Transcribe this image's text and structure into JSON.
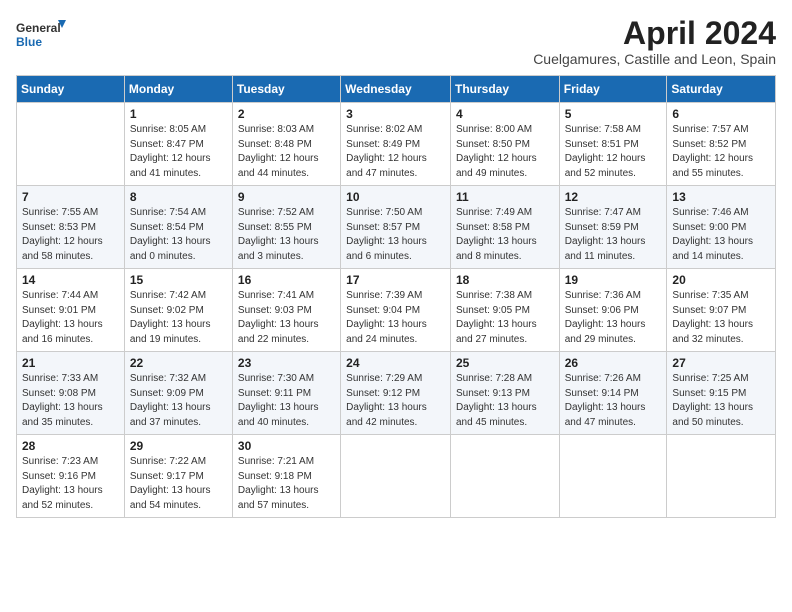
{
  "logo": {
    "text_general": "General",
    "text_blue": "Blue"
  },
  "title": "April 2024",
  "subtitle": "Cuelgamures, Castille and Leon, Spain",
  "calendar": {
    "headers": [
      "Sunday",
      "Monday",
      "Tuesday",
      "Wednesday",
      "Thursday",
      "Friday",
      "Saturday"
    ],
    "weeks": [
      [
        {
          "day": "",
          "info": ""
        },
        {
          "day": "1",
          "info": "Sunrise: 8:05 AM\nSunset: 8:47 PM\nDaylight: 12 hours\nand 41 minutes."
        },
        {
          "day": "2",
          "info": "Sunrise: 8:03 AM\nSunset: 8:48 PM\nDaylight: 12 hours\nand 44 minutes."
        },
        {
          "day": "3",
          "info": "Sunrise: 8:02 AM\nSunset: 8:49 PM\nDaylight: 12 hours\nand 47 minutes."
        },
        {
          "day": "4",
          "info": "Sunrise: 8:00 AM\nSunset: 8:50 PM\nDaylight: 12 hours\nand 49 minutes."
        },
        {
          "day": "5",
          "info": "Sunrise: 7:58 AM\nSunset: 8:51 PM\nDaylight: 12 hours\nand 52 minutes."
        },
        {
          "day": "6",
          "info": "Sunrise: 7:57 AM\nSunset: 8:52 PM\nDaylight: 12 hours\nand 55 minutes."
        }
      ],
      [
        {
          "day": "7",
          "info": "Sunrise: 7:55 AM\nSunset: 8:53 PM\nDaylight: 12 hours\nand 58 minutes."
        },
        {
          "day": "8",
          "info": "Sunrise: 7:54 AM\nSunset: 8:54 PM\nDaylight: 13 hours\nand 0 minutes."
        },
        {
          "day": "9",
          "info": "Sunrise: 7:52 AM\nSunset: 8:55 PM\nDaylight: 13 hours\nand 3 minutes."
        },
        {
          "day": "10",
          "info": "Sunrise: 7:50 AM\nSunset: 8:57 PM\nDaylight: 13 hours\nand 6 minutes."
        },
        {
          "day": "11",
          "info": "Sunrise: 7:49 AM\nSunset: 8:58 PM\nDaylight: 13 hours\nand 8 minutes."
        },
        {
          "day": "12",
          "info": "Sunrise: 7:47 AM\nSunset: 8:59 PM\nDaylight: 13 hours\nand 11 minutes."
        },
        {
          "day": "13",
          "info": "Sunrise: 7:46 AM\nSunset: 9:00 PM\nDaylight: 13 hours\nand 14 minutes."
        }
      ],
      [
        {
          "day": "14",
          "info": "Sunrise: 7:44 AM\nSunset: 9:01 PM\nDaylight: 13 hours\nand 16 minutes."
        },
        {
          "day": "15",
          "info": "Sunrise: 7:42 AM\nSunset: 9:02 PM\nDaylight: 13 hours\nand 19 minutes."
        },
        {
          "day": "16",
          "info": "Sunrise: 7:41 AM\nSunset: 9:03 PM\nDaylight: 13 hours\nand 22 minutes."
        },
        {
          "day": "17",
          "info": "Sunrise: 7:39 AM\nSunset: 9:04 PM\nDaylight: 13 hours\nand 24 minutes."
        },
        {
          "day": "18",
          "info": "Sunrise: 7:38 AM\nSunset: 9:05 PM\nDaylight: 13 hours\nand 27 minutes."
        },
        {
          "day": "19",
          "info": "Sunrise: 7:36 AM\nSunset: 9:06 PM\nDaylight: 13 hours\nand 29 minutes."
        },
        {
          "day": "20",
          "info": "Sunrise: 7:35 AM\nSunset: 9:07 PM\nDaylight: 13 hours\nand 32 minutes."
        }
      ],
      [
        {
          "day": "21",
          "info": "Sunrise: 7:33 AM\nSunset: 9:08 PM\nDaylight: 13 hours\nand 35 minutes."
        },
        {
          "day": "22",
          "info": "Sunrise: 7:32 AM\nSunset: 9:09 PM\nDaylight: 13 hours\nand 37 minutes."
        },
        {
          "day": "23",
          "info": "Sunrise: 7:30 AM\nSunset: 9:11 PM\nDaylight: 13 hours\nand 40 minutes."
        },
        {
          "day": "24",
          "info": "Sunrise: 7:29 AM\nSunset: 9:12 PM\nDaylight: 13 hours\nand 42 minutes."
        },
        {
          "day": "25",
          "info": "Sunrise: 7:28 AM\nSunset: 9:13 PM\nDaylight: 13 hours\nand 45 minutes."
        },
        {
          "day": "26",
          "info": "Sunrise: 7:26 AM\nSunset: 9:14 PM\nDaylight: 13 hours\nand 47 minutes."
        },
        {
          "day": "27",
          "info": "Sunrise: 7:25 AM\nSunset: 9:15 PM\nDaylight: 13 hours\nand 50 minutes."
        }
      ],
      [
        {
          "day": "28",
          "info": "Sunrise: 7:23 AM\nSunset: 9:16 PM\nDaylight: 13 hours\nand 52 minutes."
        },
        {
          "day": "29",
          "info": "Sunrise: 7:22 AM\nSunset: 9:17 PM\nDaylight: 13 hours\nand 54 minutes."
        },
        {
          "day": "30",
          "info": "Sunrise: 7:21 AM\nSunset: 9:18 PM\nDaylight: 13 hours\nand 57 minutes."
        },
        {
          "day": "",
          "info": ""
        },
        {
          "day": "",
          "info": ""
        },
        {
          "day": "",
          "info": ""
        },
        {
          "day": "",
          "info": ""
        }
      ]
    ]
  }
}
